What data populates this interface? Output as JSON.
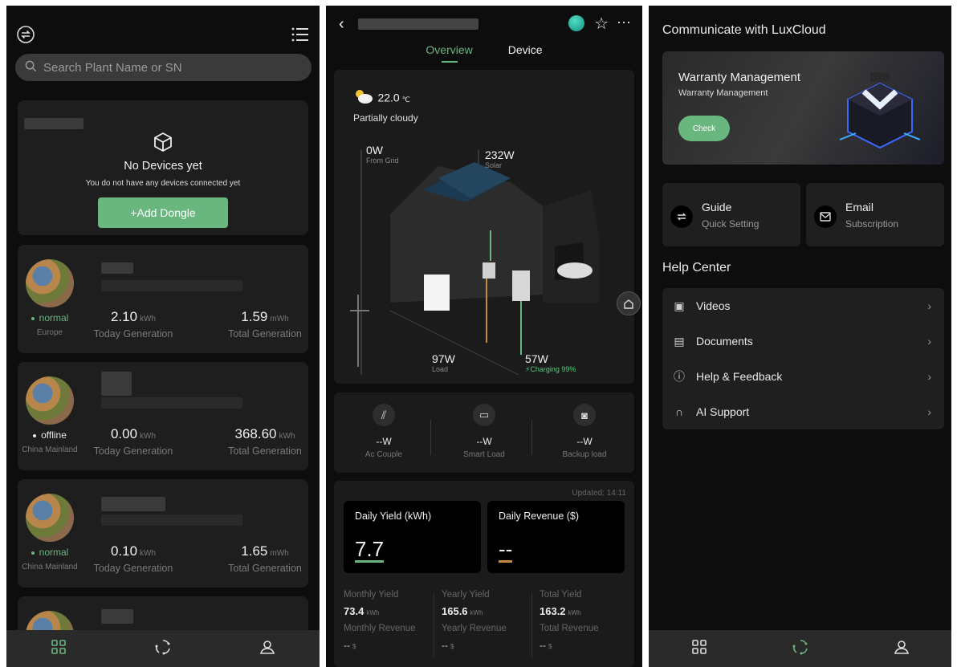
{
  "screen1": {
    "search_placeholder": "Search Plant Name or SN",
    "no_devices_title": "No Devices yet",
    "no_devices_sub": "You do not have any devices connected yet",
    "add_dongle": "+Add Dongle",
    "plants": [
      {
        "status": "normal",
        "region": "Europe",
        "today_value": "2.10",
        "today_unit": "kWh",
        "today_label": "Today Generation",
        "total_value": "1.59",
        "total_unit": "mWh",
        "total_label": "Total Generation"
      },
      {
        "status": "offline",
        "region": "China Mainland",
        "today_value": "0.00",
        "today_unit": "kWh",
        "today_label": "Today Generation",
        "total_value": "368.60",
        "total_unit": "kWh",
        "total_label": "Total Generation"
      },
      {
        "status": "normal",
        "region": "China Mainland",
        "today_value": "0.10",
        "today_unit": "kWh",
        "today_label": "Today Generation",
        "total_value": "1.65",
        "total_unit": "mWh",
        "total_label": "Total Generation"
      }
    ]
  },
  "screen2": {
    "tabs": [
      "Overview",
      "Device"
    ],
    "weather": {
      "temp": "22.0",
      "unit": "℃",
      "desc": "Partially cloudy"
    },
    "flows": {
      "grid": {
        "value": "0W",
        "label": "From Grid"
      },
      "solar": {
        "value": "232W",
        "label": "Solar"
      },
      "load": {
        "value": "97W",
        "label": "Load"
      },
      "battery": {
        "value": "57W",
        "label": "Charging 99%"
      }
    },
    "loads": [
      {
        "value": "--W",
        "label": "Ac Couple"
      },
      {
        "value": "--W",
        "label": "Smart Load"
      },
      {
        "value": "--W",
        "label": "Backup load"
      }
    ],
    "updated": "Updated: 14:11",
    "daily_yield_label": "Daily Yield (kWh)",
    "daily_yield_value": "7.7",
    "daily_revenue_label": "Daily Revenue ($)",
    "daily_revenue_value": "--",
    "stats": [
      {
        "label": "Monthly Yield",
        "value": "73.4",
        "unit": "kWh",
        "rev_label": "Monthly Revenue",
        "rev_value": "--",
        "rev_unit": "$"
      },
      {
        "label": "Yearly Yield",
        "value": "165.6",
        "unit": "kWh",
        "rev_label": "Yearly Revenue",
        "rev_value": "--",
        "rev_unit": "$"
      },
      {
        "label": "Total Yield",
        "value": "163.2",
        "unit": "kWh",
        "rev_label": "Total Revenue",
        "rev_value": "--",
        "rev_unit": "$"
      }
    ]
  },
  "screen3": {
    "communicate_title": "Communicate with LuxCloud",
    "banner_title": "Warranty Management",
    "banner_sub": "Warranty Management",
    "banner_button": "Check",
    "quick": [
      {
        "title": "Guide",
        "sub": "Quick Setting"
      },
      {
        "title": "Email",
        "sub": "Subscription"
      }
    ],
    "help_title": "Help Center",
    "help_items": [
      "Videos",
      "Documents",
      "Help & Feedback",
      "AI Support"
    ]
  },
  "colors": {
    "accent": "#6ab67f",
    "background": "#0d0d0d",
    "card": "#1e1e1e"
  }
}
